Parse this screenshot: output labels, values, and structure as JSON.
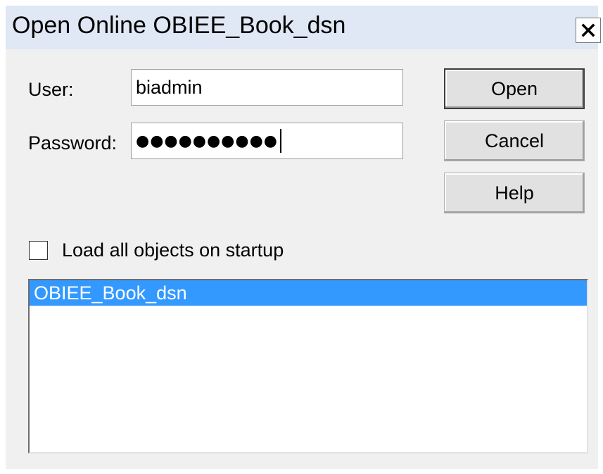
{
  "window": {
    "title": "Open Online OBIEE_Book_dsn",
    "close_icon": "close-icon"
  },
  "form": {
    "user_label": "User:",
    "user_value": "biadmin",
    "password_label": "Password:",
    "password_mask": "●●●●●●●●●●"
  },
  "buttons": {
    "open": "Open",
    "cancel": "Cancel",
    "help": "Help"
  },
  "options": {
    "load_all_label": "Load all objects on startup",
    "load_all_checked": false
  },
  "dsn_list": {
    "items": [
      {
        "label": "OBIEE_Book_dsn",
        "selected": true
      }
    ]
  },
  "colors": {
    "titlebar": "#dfe8f4",
    "client": "#f0f0f0",
    "selection": "#3399ff"
  }
}
